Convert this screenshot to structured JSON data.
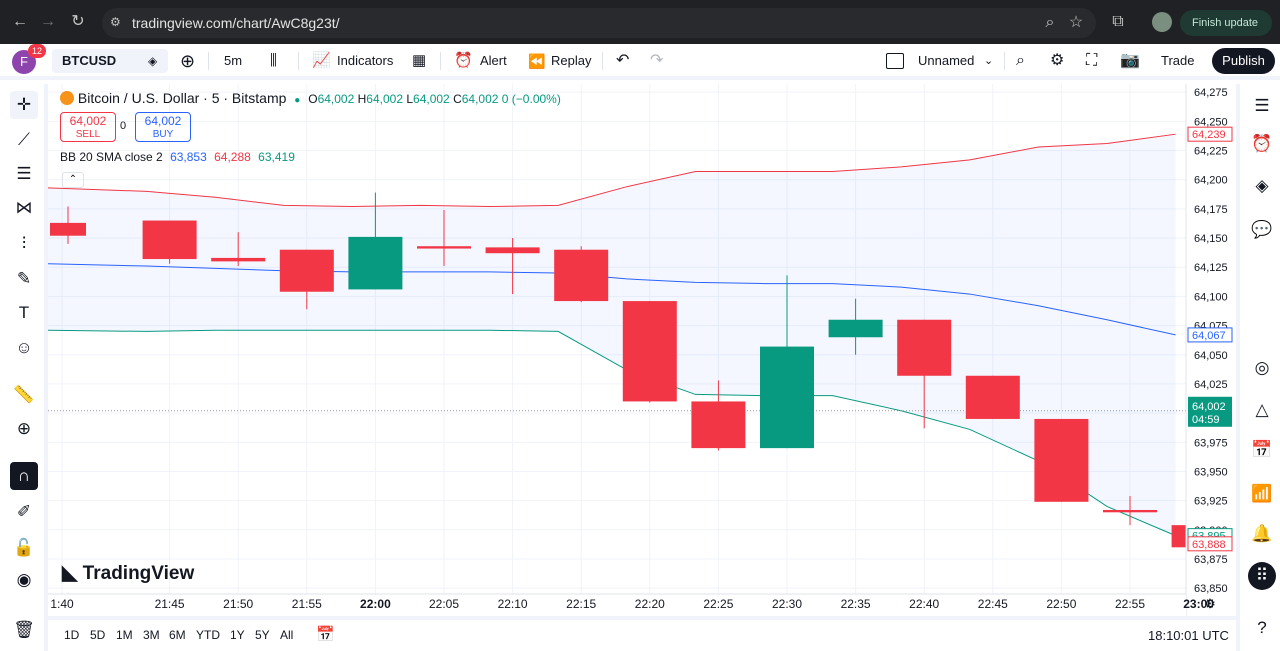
{
  "browser": {
    "url": "tradingview.com/chart/AwC8g23t/",
    "finish_update": "Finish update"
  },
  "user": {
    "initial": "F",
    "badge": "12"
  },
  "toolbar": {
    "symbol": "BTCUSD",
    "interval": "5m",
    "indicators": "Indicators",
    "alert": "Alert",
    "replay": "Replay",
    "layout_name": "Unnamed",
    "trade": "Trade",
    "publish": "Publish"
  },
  "legend": {
    "title": "Bitcoin / U.S. Dollar · 5 · Bitstamp",
    "o_label": "O",
    "o": "64,002",
    "h_label": "H",
    "h": "64,002",
    "l_label": "L",
    "l": "64,002",
    "c_label": "C",
    "c": "64,002",
    "change": "0 (−0.00%)",
    "sell_price": "64,002",
    "sell_label": "SELL",
    "spread": "0",
    "buy_price": "64,002",
    "buy_label": "BUY",
    "bb_label": "BB 20 SMA close 2",
    "bb_basis": "63,853",
    "bb_upper": "64,288",
    "bb_lower": "63,419"
  },
  "brand": "TradingView",
  "colors": {
    "up": "#089981",
    "down": "#f23645",
    "basis": "#2962ff",
    "upper": "#f23645",
    "lower": "#089981",
    "band_fill": "#2962ff"
  },
  "chart_data": {
    "type": "candlestick",
    "y_ticks": [
      64275,
      64250,
      64225,
      64200,
      64175,
      64150,
      64125,
      64100,
      64075,
      64050,
      64025,
      64000,
      63975,
      63950,
      63925,
      63900,
      63875,
      63850
    ],
    "y_tick_labels": [
      "64,275",
      "64,250",
      "64,225",
      "64,200",
      "64,175",
      "64,150",
      "64,125",
      "64,100",
      "64,075",
      "64,050",
      "64,025",
      "64,000",
      "63,975",
      "63,950",
      "63,925",
      "63,900",
      "63,875",
      "63,850"
    ],
    "x_labels": [
      "1:40",
      "21:45",
      "21:50",
      "21:55",
      "22:00",
      "22:05",
      "22:10",
      "22:15",
      "22:20",
      "22:25",
      "22:30",
      "22:35",
      "22:40",
      "22:45",
      "22:50",
      "22:55",
      "23:00"
    ],
    "candles": [
      {
        "o": 64163,
        "h": 64177,
        "l": 64145,
        "c": 64152
      },
      {
        "o": 64165,
        "h": 64165,
        "l": 64128,
        "c": 64132
      },
      {
        "o": 64133,
        "h": 64155,
        "l": 64126,
        "c": 64130
      },
      {
        "o": 64140,
        "h": 64140,
        "l": 64089,
        "c": 64104
      },
      {
        "o": 64106,
        "h": 64189,
        "l": 64106,
        "c": 64151
      },
      {
        "o": 64143,
        "h": 64174,
        "l": 64126,
        "c": 64141
      },
      {
        "o": 64142,
        "h": 64150,
        "l": 64102,
        "c": 64137
      },
      {
        "o": 64140,
        "h": 64143,
        "l": 64095,
        "c": 64096
      },
      {
        "o": 64096,
        "h": 64096,
        "l": 64009,
        "c": 64010
      },
      {
        "o": 64010,
        "h": 64028,
        "l": 63968,
        "c": 63970
      },
      {
        "o": 63970,
        "h": 64118,
        "l": 63970,
        "c": 64057
      },
      {
        "o": 64065,
        "h": 64098,
        "l": 64050,
        "c": 64080
      },
      {
        "o": 64080,
        "h": 64080,
        "l": 63987,
        "c": 64032
      },
      {
        "o": 64032,
        "h": 64032,
        "l": 63995,
        "c": 63995
      },
      {
        "o": 63995,
        "h": 63995,
        "l": 63924,
        "c": 63924
      },
      {
        "o": 63917,
        "h": 63929,
        "l": 63904,
        "c": 63915
      },
      {
        "o": 63904,
        "h": 63953,
        "l": 63881,
        "c": 63885
      }
    ],
    "bb_upper": [
      64193,
      64190,
      64185,
      64178,
      64177,
      64178,
      64177,
      64178,
      64194,
      64207,
      64207,
      64207,
      64211,
      64217,
      64228,
      64231,
      64239
    ],
    "bb_basis": [
      64128,
      64126,
      64124,
      64122,
      64121,
      64121,
      64121,
      64120,
      64115,
      64112,
      64111,
      64111,
      64108,
      64102,
      64092,
      64080,
      64067
    ],
    "bb_lower": [
      64071,
      64070,
      64071,
      64071,
      64071,
      64071,
      64071,
      64070,
      64037,
      64016,
      64015,
      64015,
      64002,
      63986,
      63959,
      63920,
      63895
    ],
    "last_price": "64,002",
    "countdown": "04:59",
    "upper_value": "64,239",
    "basis_value": "64,067",
    "lower_value": "63,895",
    "current_label": "63,888",
    "ylim": [
      63845,
      64282
    ]
  },
  "bottom": {
    "ranges": [
      "1D",
      "5D",
      "1M",
      "3M",
      "6M",
      "YTD",
      "1Y",
      "5Y",
      "All"
    ],
    "time": "18:10:01 UTC"
  }
}
